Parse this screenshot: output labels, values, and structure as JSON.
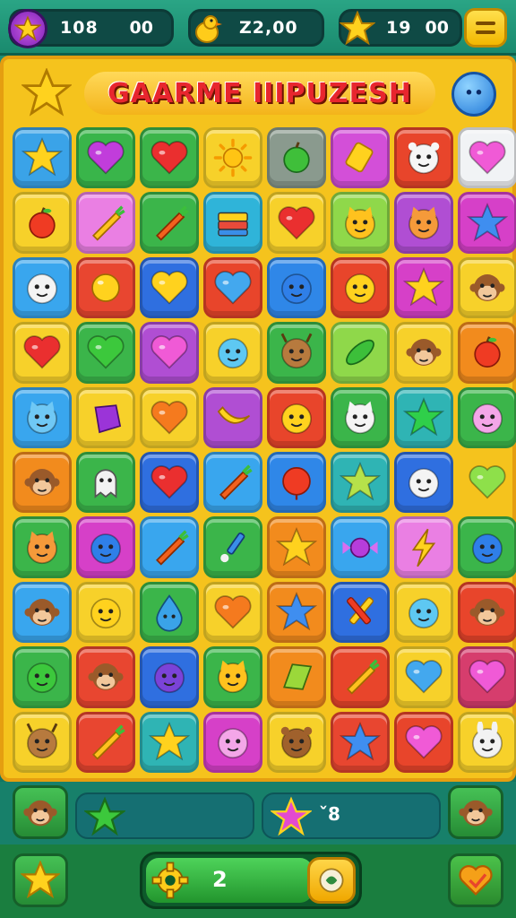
{
  "hud": {
    "stars": {
      "icon": "star-icon",
      "value": "108",
      "extra": "00"
    },
    "coins": {
      "icon": "duck-icon",
      "value": "Z2,00"
    },
    "lives": {
      "icon": "star-icon",
      "value": "19",
      "extra": "00"
    },
    "menu_icon": "menu-icon"
  },
  "board": {
    "title": "GAARME IIIPUZESH",
    "left_icon": "star-icon",
    "right_icon": "blue-blob-icon",
    "rows": [
      [
        {
          "c": "#3aa3e8",
          "i": "star"
        },
        {
          "c": "#39b54a",
          "i": "heart-purple"
        },
        {
          "c": "#3bb54a",
          "i": "heart-red"
        },
        {
          "c": "#f7d12a",
          "i": "sun"
        },
        {
          "c": "#8a9a8e",
          "i": "apple-green"
        },
        {
          "c": "#d34fd8",
          "i": "candy"
        },
        {
          "c": "#e8452b",
          "i": "bear-white"
        },
        {
          "c": "#f1f3f5",
          "i": "heart-pink"
        }
      ],
      [
        {
          "c": "#f7d12a",
          "i": "apple-red"
        },
        {
          "c": "#ea7fe3",
          "i": "carrot-yellow"
        },
        {
          "c": "#3bb54a",
          "i": "carrot"
        },
        {
          "c": "#2fb4d9",
          "i": "book"
        },
        {
          "c": "#f7d12a",
          "i": "heart-red"
        },
        {
          "c": "#8fd84a",
          "i": "cat"
        },
        {
          "c": "#b04ed3",
          "i": "fox"
        },
        {
          "c": "#d640c8",
          "i": "star-blue"
        }
      ],
      [
        {
          "c": "#39a6ee",
          "i": "face-white"
        },
        {
          "c": "#e84630",
          "i": "blob-yellow"
        },
        {
          "c": "#2f6fe0",
          "i": "heart-yellow"
        },
        {
          "c": "#e8452b",
          "i": "heart-blue"
        },
        {
          "c": "#2f87e8",
          "i": "face-blue"
        },
        {
          "c": "#e8452b",
          "i": "face-yellow"
        },
        {
          "c": "#d640c8",
          "i": "star-yellow"
        },
        {
          "c": "#f7d12a",
          "i": "monkey"
        }
      ],
      [
        {
          "c": "#f7d12a",
          "i": "heart-red"
        },
        {
          "c": "#3bb54a",
          "i": "heart-green"
        },
        {
          "c": "#b04ed3",
          "i": "heart-pink"
        },
        {
          "c": "#f7d12a",
          "i": "face-cyan"
        },
        {
          "c": "#3bb54a",
          "i": "deer"
        },
        {
          "c": "#8fd84a",
          "i": "leaf"
        },
        {
          "c": "#f7d12a",
          "i": "monkey"
        },
        {
          "c": "#f28b1d",
          "i": "apple-red"
        }
      ],
      [
        {
          "c": "#39a6ee",
          "i": "cat-blue"
        },
        {
          "c": "#f7d12a",
          "i": "gem-purple"
        },
        {
          "c": "#f7d12a",
          "i": "heart-orange"
        },
        {
          "c": "#b04ed3",
          "i": "banana"
        },
        {
          "c": "#e8452b",
          "i": "face-yellow"
        },
        {
          "c": "#3bb54a",
          "i": "cat-white"
        },
        {
          "c": "#2fb4b4",
          "i": "star-green"
        },
        {
          "c": "#3bb54a",
          "i": "face-pink"
        }
      ],
      [
        {
          "c": "#f28b1d",
          "i": "monkey"
        },
        {
          "c": "#3bb54a",
          "i": "ghost"
        },
        {
          "c": "#2f6fe0",
          "i": "heart-red"
        },
        {
          "c": "#39a6ee",
          "i": "carrot"
        },
        {
          "c": "#2f87e8",
          "i": "blob-red"
        },
        {
          "c": "#2fb4b4",
          "i": "star-lime"
        },
        {
          "c": "#2f6fe0",
          "i": "face-white"
        },
        {
          "c": "none",
          "i": "heart-lime"
        }
      ],
      [
        {
          "c": "#3bb54a",
          "i": "fox"
        },
        {
          "c": "#d640c8",
          "i": "face-blue"
        },
        {
          "c": "#39a6ee",
          "i": "carrot"
        },
        {
          "c": "#3bb54a",
          "i": "brush"
        },
        {
          "c": "#f28b1d",
          "i": "star-yellow"
        },
        {
          "c": "#39a6ee",
          "i": "candy-purple"
        },
        {
          "c": "#ea7fe3",
          "i": "bolt"
        },
        {
          "c": "#3bb54a",
          "i": "face-blue"
        }
      ],
      [
        {
          "c": "#39a6ee",
          "i": "monkey"
        },
        {
          "c": "#f7d12a",
          "i": "face-yellow"
        },
        {
          "c": "#3bb54a",
          "i": "drop"
        },
        {
          "c": "#f7d12a",
          "i": "heart-orange"
        },
        {
          "c": "#f28b1d",
          "i": "star-blue"
        },
        {
          "c": "#2f6fe0",
          "i": "pencils"
        },
        {
          "c": "#f7d12a",
          "i": "face-cyan"
        },
        {
          "c": "#e8452b",
          "i": "monkey"
        }
      ],
      [
        {
          "c": "#3bb54a",
          "i": "blob-green"
        },
        {
          "c": "#e84630",
          "i": "monkey"
        },
        {
          "c": "#2f6fe0",
          "i": "face-purple"
        },
        {
          "c": "#3bb54a",
          "i": "cat"
        },
        {
          "c": "#f28b1d",
          "i": "gem-green"
        },
        {
          "c": "#e8452b",
          "i": "carrot-yellow"
        },
        {
          "c": "#f7d12a",
          "i": "heart-blue"
        },
        {
          "c": "#d63d6d",
          "i": "heart-pink"
        }
      ],
      [
        {
          "c": "#f7d12a",
          "i": "deer"
        },
        {
          "c": "#e84630",
          "i": "carrot-yellow"
        },
        {
          "c": "#2fb4b4",
          "i": "star-yellow"
        },
        {
          "c": "#d640c8",
          "i": "face-pink"
        },
        {
          "c": "#f7d12a",
          "i": "bear"
        },
        {
          "c": "#e84630",
          "i": "star-blue"
        },
        {
          "c": "#e8452b",
          "i": "heart-pink"
        },
        {
          "c": "#f7d12a",
          "i": "bunny"
        }
      ]
    ]
  },
  "footer": {
    "left_button_icon": "monkey-icon",
    "panel1_icon": "star-green-icon",
    "panel2_icon": "star-pink-icon",
    "panel2_value": "ˇ8",
    "right_button_icon": "monkey-icon",
    "bottom_left_icon": "star-icon",
    "progress_icon": "gear-icon",
    "progress_value": "2",
    "progress_level": 0.8,
    "knob_icon": "blob-icon",
    "bottom_right_icon": "heart-icon"
  }
}
